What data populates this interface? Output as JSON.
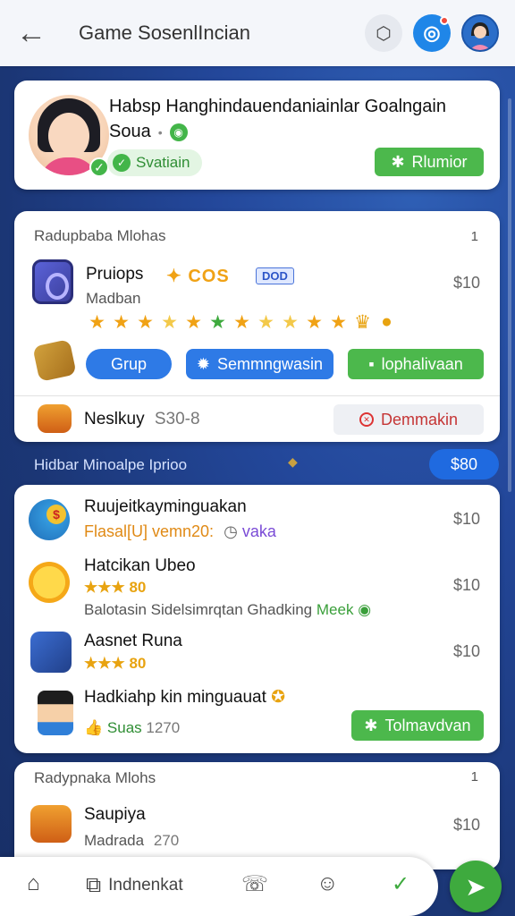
{
  "header": {
    "back_icon": "arrow-left-icon",
    "title": "Game SosenlIncian",
    "icons": [
      "settings-icon",
      "app-icon",
      "avatar"
    ]
  },
  "profile": {
    "name": "Habsp Hanghindauendaniainlar Goalngain",
    "subtitle": "Soua",
    "status": "Svatiain",
    "button": "Rlumior"
  },
  "section1": {
    "heading": "Radupbaba Mlohas",
    "count": "1",
    "item1": {
      "title": "Pruiops",
      "coins": "COS",
      "tag": "DOD",
      "price": "$10",
      "sub": "Madban",
      "stars": [
        "★",
        "★",
        "★",
        "★",
        "★",
        "★",
        "★",
        "★",
        "★",
        "★",
        "★",
        "♛",
        "●"
      ]
    },
    "buttons": {
      "grup": "Grup",
      "sen": "Semmngwasin",
      "top": "lophalivaan"
    },
    "item2": {
      "title": "Neslkuy",
      "meta": "S30-8",
      "button": "Demmakin"
    }
  },
  "midbar": {
    "text": "Hidbar Minoalpe Iprioo",
    "button": "$80"
  },
  "section2": {
    "items": [
      {
        "title": "Ruujeitkayminguakan",
        "line": "Flasal[U] vemn20:",
        "extra": "vaka",
        "price": "$10"
      },
      {
        "title": "Hatcikan Ubeo",
        "rating": "★★★ 80",
        "price": "$10",
        "sub": "Balotasin Sidelsimrqtan Ghadking",
        "sub_green": "Meek"
      },
      {
        "title": "Aasnet Runa",
        "rating": "★★★ 80",
        "price": "$10"
      },
      {
        "title": "Hadkiahp kin minguauat",
        "meta_gold": "Suas",
        "meta": "1270",
        "button": "Tolmavdvan"
      }
    ]
  },
  "section3": {
    "heading": "Radypnaka Mlohs",
    "count": "1",
    "item": {
      "title": "Saupiya",
      "sub": "Madrada",
      "meta": "270",
      "price": "$10"
    }
  },
  "bottomnav": {
    "label": "Indnenkat",
    "icons": [
      "home-icon",
      "camera-icon",
      "whatsapp-icon",
      "chat-icon",
      "check-circle-icon"
    ],
    "fab_icon": "send-icon"
  },
  "colors": {
    "primary_blue": "#2e7ae6",
    "green": "#4cb84c",
    "background": "#1f3f86"
  }
}
